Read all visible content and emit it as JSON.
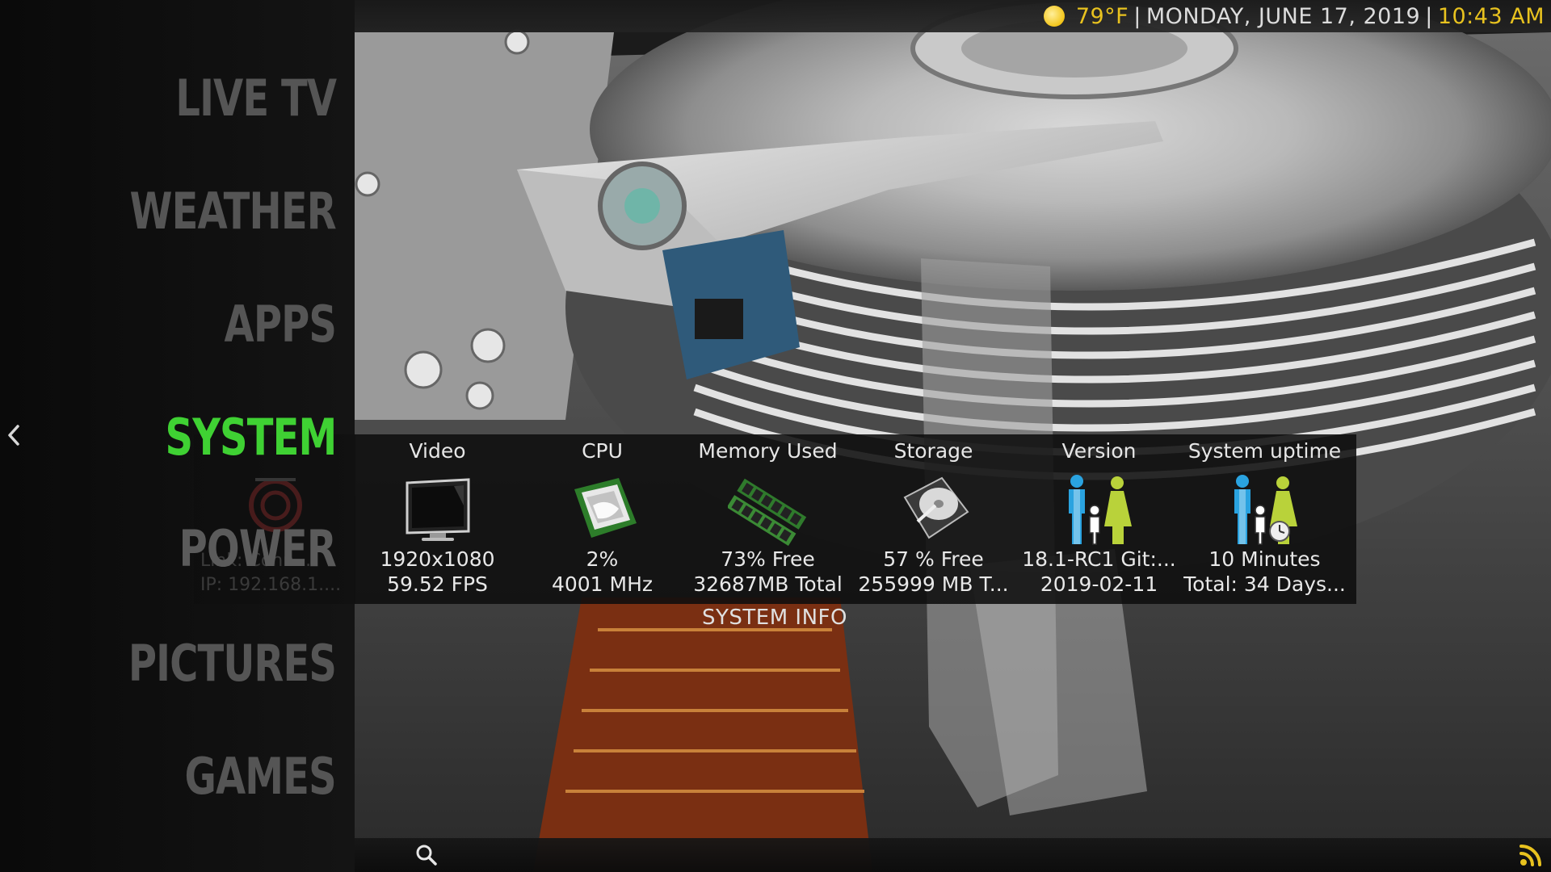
{
  "topbar": {
    "weather_icon": "sun-icon",
    "temperature": "79°F",
    "separator": "|",
    "date": "MONDAY, JUNE 17, 2019",
    "time": "10:43 AM"
  },
  "menu": {
    "items": [
      {
        "label": "LIVE TV"
      },
      {
        "label": "WEATHER"
      },
      {
        "label": "APPS"
      },
      {
        "label": "SYSTEM",
        "active": true
      },
      {
        "label": "POWER"
      },
      {
        "label": "PICTURES"
      },
      {
        "label": "GAMES"
      }
    ]
  },
  "network": {
    "line1": "Link: Conn...",
    "line2": "IP: 192.168.1...."
  },
  "system_info": {
    "label": "SYSTEM INFO",
    "columns": [
      {
        "title": "Video",
        "icon": "monitor-icon",
        "line1": "1920x1080",
        "line2": "59.52 FPS"
      },
      {
        "title": "CPU",
        "icon": "cpu-chip-icon",
        "line1": "2%",
        "line2": "4001 MHz"
      },
      {
        "title": "Memory Used",
        "icon": "ram-module-icon",
        "line1": "73% Free",
        "line2": "32687MB Total"
      },
      {
        "title": "Storage",
        "icon": "hard-drive-icon",
        "line1": "57 % Free",
        "line2": "255999 MB T..."
      },
      {
        "title": "Version",
        "icon": "family-icon",
        "line1": "18.1-RC1 Git:...",
        "line2": "2019-02-11"
      },
      {
        "title": "System uptime",
        "icon": "family-clock-icon",
        "line1": "10 Minutes",
        "line2": "Total: 34 Days..."
      }
    ]
  },
  "bottombar": {
    "search_icon": "search-icon",
    "rss_icon": "rss-icon"
  },
  "colors": {
    "accent_green": "#3fd133",
    "accent_yellow": "#e8c21f",
    "menu_inactive": "#555555"
  }
}
